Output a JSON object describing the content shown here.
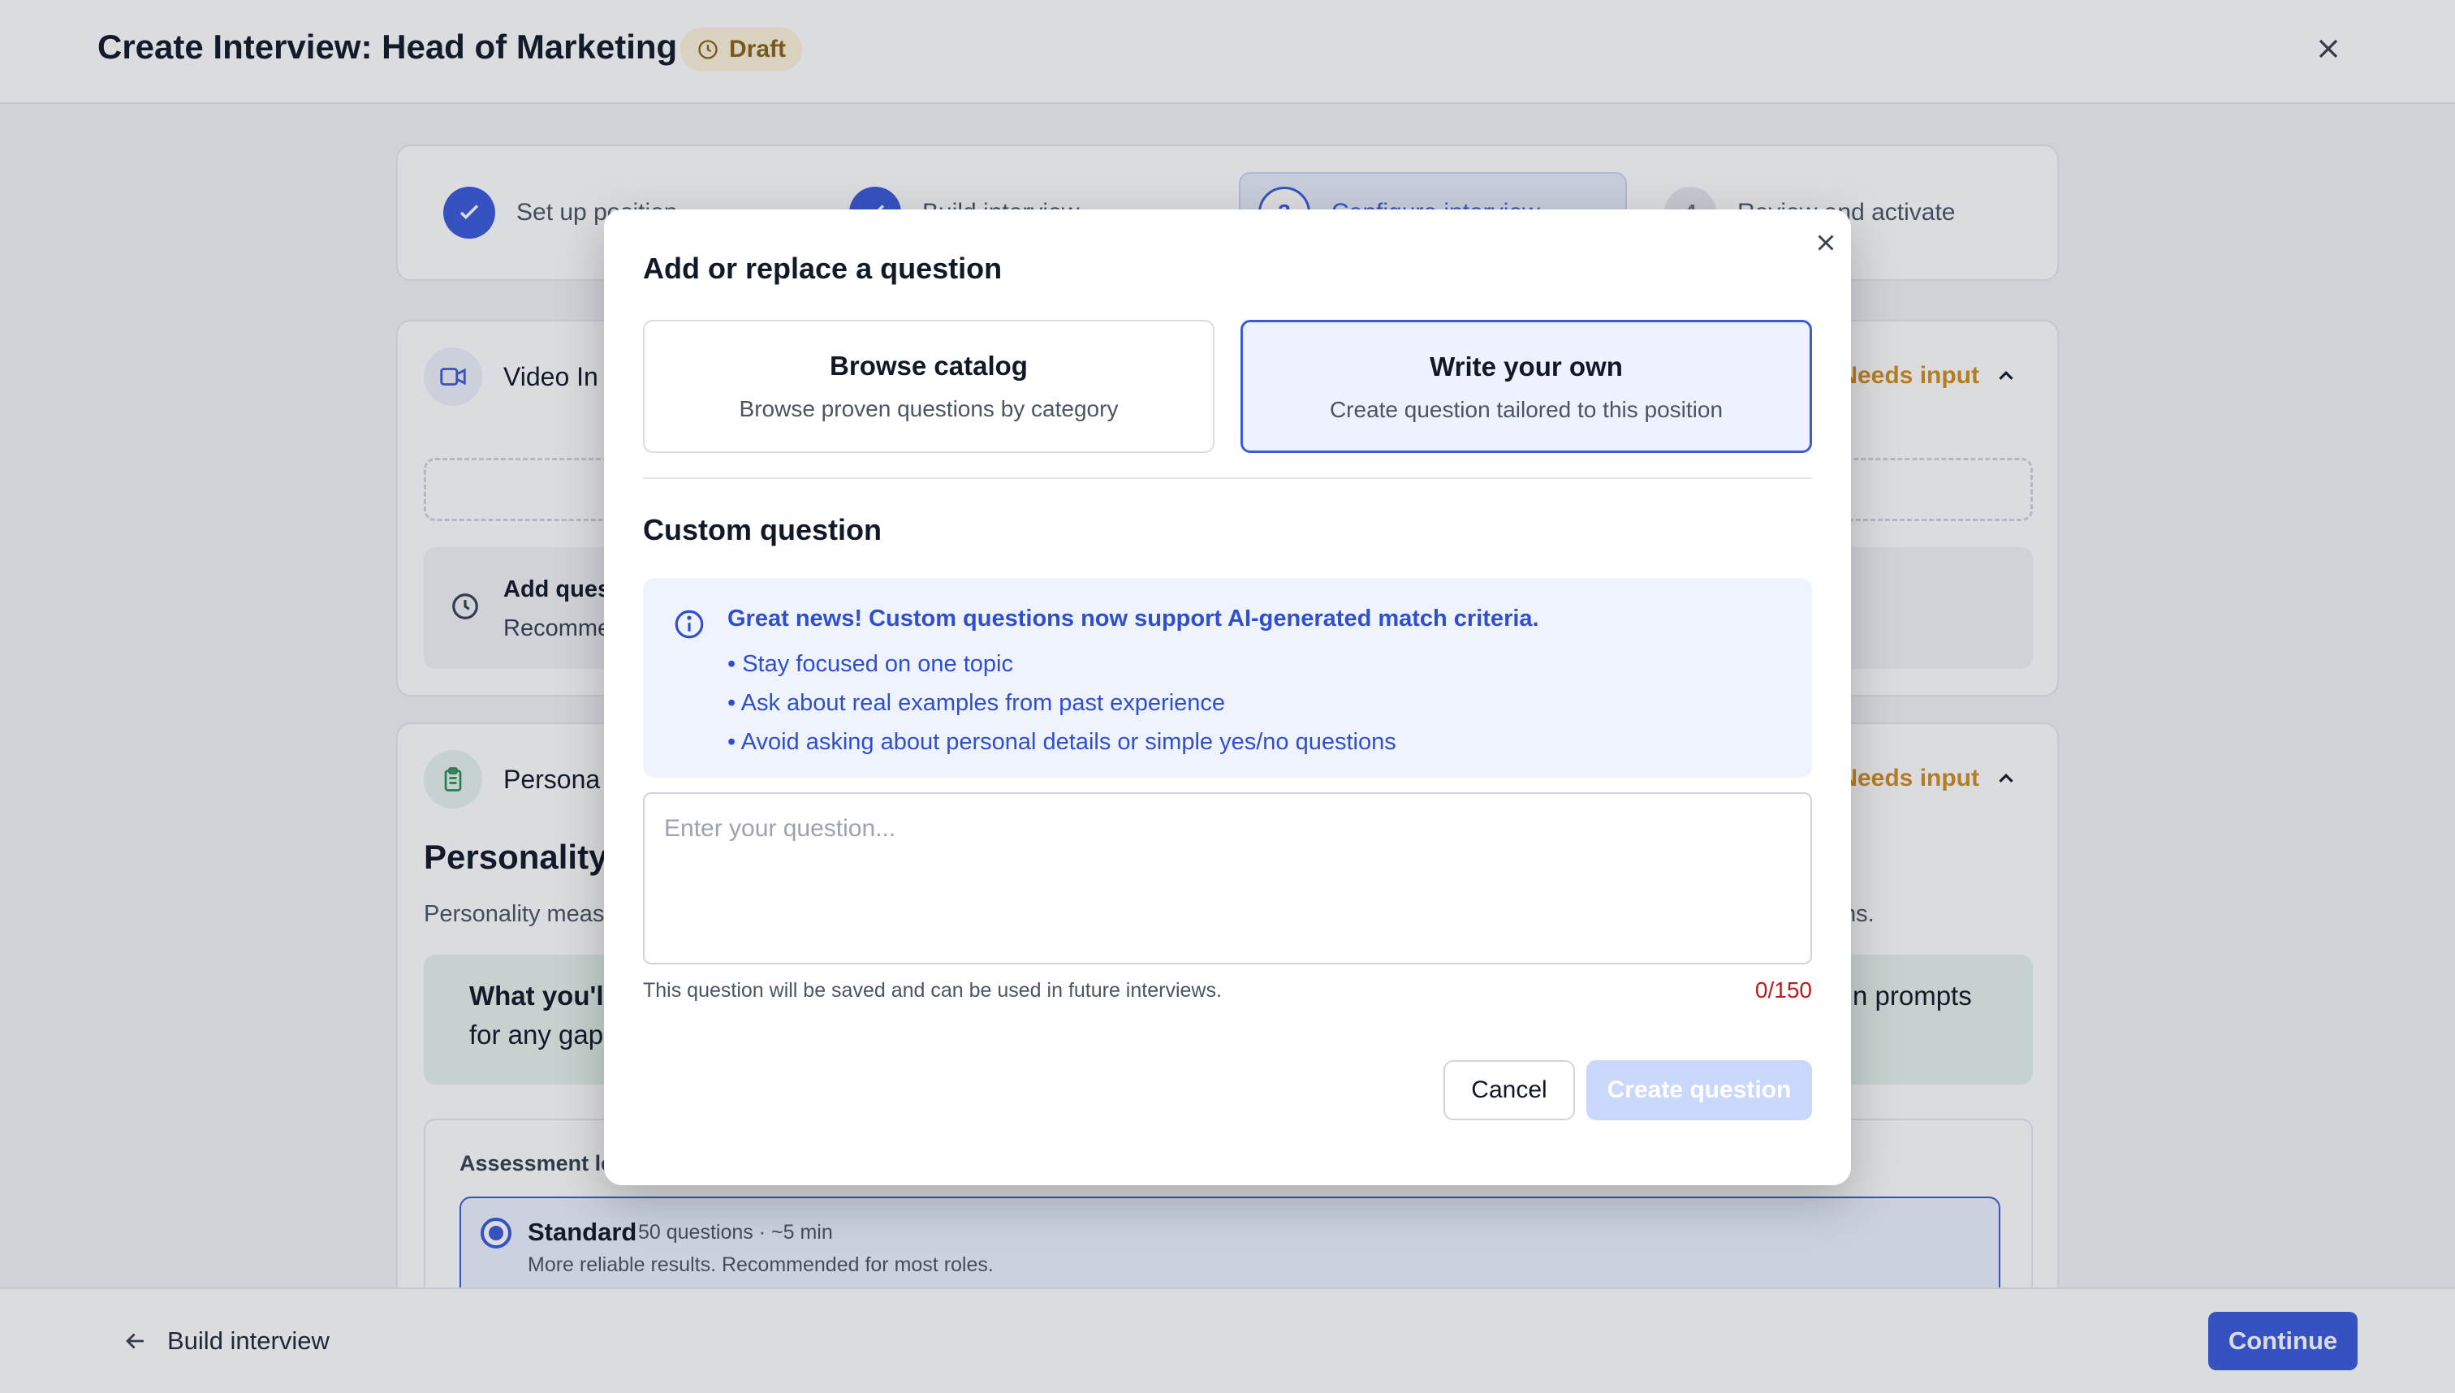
{
  "header": {
    "title": "Create Interview: Head of Marketing",
    "status_badge": "Draft"
  },
  "stepper": {
    "steps": [
      {
        "number": "",
        "label": "Set up position",
        "state": "done"
      },
      {
        "number": "",
        "label": "Build interview",
        "state": "done"
      },
      {
        "number": "3",
        "label": "Configure interview",
        "state": "current"
      },
      {
        "number": "4",
        "label": "Review and activate",
        "state": "todo"
      }
    ]
  },
  "video_section": {
    "title": "Video In",
    "status": "Needs input",
    "tip_line1": "Add ques",
    "tip_line2": "Recomme"
  },
  "personality_section": {
    "title": "Persona",
    "status": "Needs input",
    "heading": "Personality",
    "description_left": "Personality meas",
    "description_right": "ths.",
    "callout_bold": "What you'l",
    "callout_line2": "for any gap",
    "callout_right": "n prompts",
    "assessment_label": "Assessment le",
    "option": {
      "title": "Standard",
      "meta": "50 questions · ~5 min",
      "description": "More reliable results. Recommended for most roles."
    }
  },
  "footer": {
    "back_label": "Build interview",
    "continue_label": "Continue"
  },
  "modal": {
    "title": "Add or replace a question",
    "options": [
      {
        "title": "Browse catalog",
        "subtitle": "Browse proven questions by category",
        "selected": false
      },
      {
        "title": "Write your own",
        "subtitle": "Create question tailored to this position",
        "selected": true
      }
    ],
    "section_title": "Custom question",
    "info": {
      "headline": "Great news! Custom questions now support AI-generated match criteria.",
      "bullets": [
        "Stay focused on one topic",
        "Ask about real examples from past experience",
        "Avoid asking about personal details or simple yes/no questions"
      ]
    },
    "input": {
      "value": "",
      "placeholder": "Enter your question..."
    },
    "helper_text": "This question will be saved and can be used in future interviews.",
    "char_count": "0/150",
    "cancel_label": "Cancel",
    "create_label": "Create question"
  },
  "colors": {
    "accent": "#3b5bdb",
    "warning": "#d28d1c",
    "draft_bg": "#fdf3dc",
    "info_bg": "#eef3fe",
    "counter": "#b91c1c"
  },
  "icons": {
    "close": "close-icon",
    "clock": "clock-icon",
    "video": "video-icon",
    "clipboard": "clipboard-icon",
    "info": "info-icon",
    "check": "check-icon",
    "chevron_up": "chevron-up-icon",
    "arrow_left": "arrow-left-icon"
  }
}
